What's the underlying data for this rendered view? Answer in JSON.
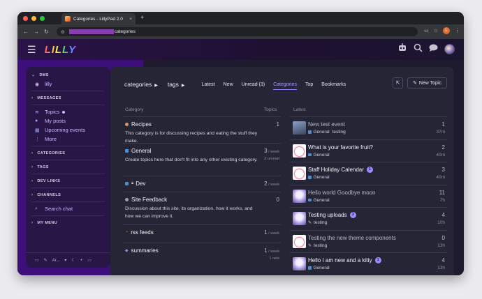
{
  "browser": {
    "tab_title": "Categories - LillyPad 2.0",
    "tab_close": "×",
    "new_tab": "+",
    "url_path": "categories",
    "profile_initial": "L"
  },
  "site": {
    "logo_text": "LILLY",
    "accent_color": "#3d0f7a"
  },
  "sidebar": {
    "sections": {
      "dms": "DMS",
      "messages": "MESSAGES",
      "categories": "CATEGORIES",
      "tags": "TAGS",
      "dev_links": "DEV LINKS",
      "channels": "CHANNELS",
      "my_menu": "MY MENU"
    },
    "dm_user": "lilly",
    "items": [
      {
        "label": "Topics",
        "icon": "layers-icon"
      },
      {
        "label": "My posts",
        "icon": "user-icon"
      },
      {
        "label": "Upcoming events",
        "icon": "calendar-icon"
      },
      {
        "label": "More",
        "icon": "more-icon"
      }
    ],
    "search_chat": "Search chat",
    "footer_theme": "Ar..."
  },
  "nav": {
    "crumb_categories": "categories",
    "crumb_tags": "tags",
    "links": [
      "Latest",
      "New",
      "Unread (3)",
      "Categories",
      "Top",
      "Bookmarks"
    ],
    "active": "Categories",
    "new_topic": "New Topic"
  },
  "categories_table": {
    "header_category": "Category",
    "header_topics": "Topics",
    "rows": [
      {
        "name": "Recipes",
        "color": "#d99a6c",
        "description": "This category is for discussing recipes and eating the stuff they make.",
        "count": "1",
        "per": "",
        "sub": ""
      },
      {
        "name": "General",
        "color": "#4a90d9",
        "description": "Create topics here that don't fit into any other existing category.",
        "count": "3",
        "per": " / week",
        "sub": "2 unread"
      },
      {
        "name": "Dev",
        "color": "#4a90d9",
        "description": "",
        "count": "2",
        "per": " / week",
        "sub": ""
      },
      {
        "name": "Site Feedback",
        "color": "#9aa0b0",
        "description": "Discussion about this site, its organization, how it works, and how we can improve it.",
        "count": "0",
        "per": "",
        "sub": ""
      },
      {
        "name": "rss feeds",
        "color": "#e0603c",
        "description": "",
        "count": "1",
        "per": " / week",
        "sub": ""
      },
      {
        "name": "summaries",
        "color": "#8a8ae0",
        "description": "",
        "count": "1",
        "per": " / week",
        "sub": "1 new"
      }
    ]
  },
  "latest": {
    "header": "Latest",
    "topics": [
      {
        "title": "New test event",
        "read": true,
        "badge": "",
        "category": "General",
        "tag": "testing",
        "replies": "1",
        "age": "37m",
        "avatar": "#6a7fa8"
      },
      {
        "title": "What is your favorite fruit?",
        "read": false,
        "badge": "",
        "category": "General",
        "tag": "",
        "replies": "2",
        "age": "40m",
        "avatar": "#f5f0f5"
      },
      {
        "title": "Staff Holiday Calendar",
        "read": false,
        "badge": "1",
        "category": "General",
        "tag": "",
        "replies": "3",
        "age": "40m",
        "avatar": "#f5f0f5"
      },
      {
        "title": "Hello world Goodbye moon",
        "read": true,
        "badge": "",
        "category": "General",
        "tag": "",
        "replies": "11",
        "age": "7h",
        "avatar": "#b8a6e8"
      },
      {
        "title": "Testing uploads",
        "read": false,
        "badge": "3",
        "category": "testing",
        "tag": "",
        "replies": "4",
        "age": "10h",
        "avatar": "#b8a6e8"
      },
      {
        "title": "Testing the new theme components",
        "read": true,
        "badge": "",
        "category": "testing",
        "tag": "",
        "replies": "0",
        "age": "13h",
        "avatar": "#f5f0f5"
      },
      {
        "title": "Hello I am new and a kitty",
        "read": false,
        "badge": "1",
        "category": "General",
        "tag": "",
        "replies": "4",
        "age": "13h",
        "avatar": "#b8a6e8"
      }
    ]
  }
}
